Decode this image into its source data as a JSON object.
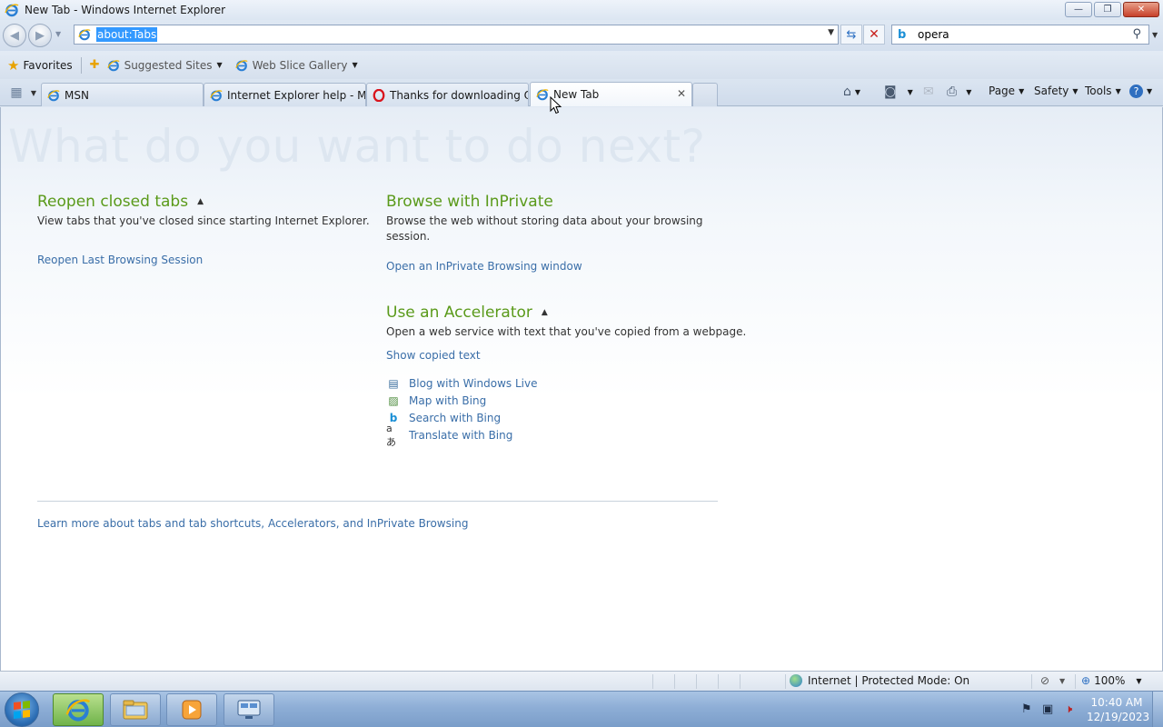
{
  "window": {
    "title": "New Tab - Windows Internet Explorer",
    "minimize": "—",
    "restore": "❐",
    "close": "✕"
  },
  "navigation": {
    "back_icon": "back-arrow-icon",
    "forward_icon": "forward-arrow-icon",
    "address_value": "about:Tabs",
    "search_value": "opera",
    "search_provider_icon": "bing-icon"
  },
  "favorites_bar": {
    "favorites_label": "Favorites",
    "items": [
      {
        "label": "Suggested Sites"
      },
      {
        "label": "Web Slice Gallery"
      }
    ]
  },
  "tabs": [
    {
      "label": "MSN",
      "icon": "ie-icon"
    },
    {
      "label": "Internet Explorer help - Mi...",
      "icon": "ie-icon"
    },
    {
      "label": "Thanks for downloading O...",
      "icon": "opera-icon"
    },
    {
      "label": "New Tab",
      "icon": "ie-icon",
      "active": true
    }
  ],
  "command_bar": {
    "page": "Page",
    "safety": "Safety",
    "tools": "Tools"
  },
  "content": {
    "hero": "What do you want to do next?",
    "reopen": {
      "title": "Reopen closed tabs",
      "description": "View tabs that you've closed since starting Internet Explorer.",
      "link": "Reopen Last Browsing Session"
    },
    "inprivate": {
      "title": "Browse with InPrivate",
      "description_line1": "Browse the web without storing data about your browsing",
      "description_line2": "session.",
      "link": "Open an InPrivate Browsing window"
    },
    "accelerator": {
      "title": "Use an Accelerator",
      "description": "Open a web service with text that you've copied from a webpage.",
      "show_copied": "Show copied text",
      "items": [
        {
          "label": "Blog with Windows Live",
          "icon": "windows-live-blog-icon"
        },
        {
          "label": "Map with Bing",
          "icon": "map-icon"
        },
        {
          "label": "Search with Bing",
          "icon": "bing-icon"
        },
        {
          "label": "Translate with Bing",
          "icon": "translate-icon"
        }
      ]
    },
    "learn_more": "Learn more about tabs and tab shortcuts, Accelerators, and InPrivate Browsing"
  },
  "status_bar": {
    "zone": "Internet | Protected Mode: On",
    "zoom": "100%"
  },
  "taskbar": {
    "time": "10:40 AM",
    "date": "12/19/2023"
  },
  "colors": {
    "section_title": "#5a9a1a",
    "link": "#3a6ea8",
    "hero_text": "#dde6f0"
  }
}
